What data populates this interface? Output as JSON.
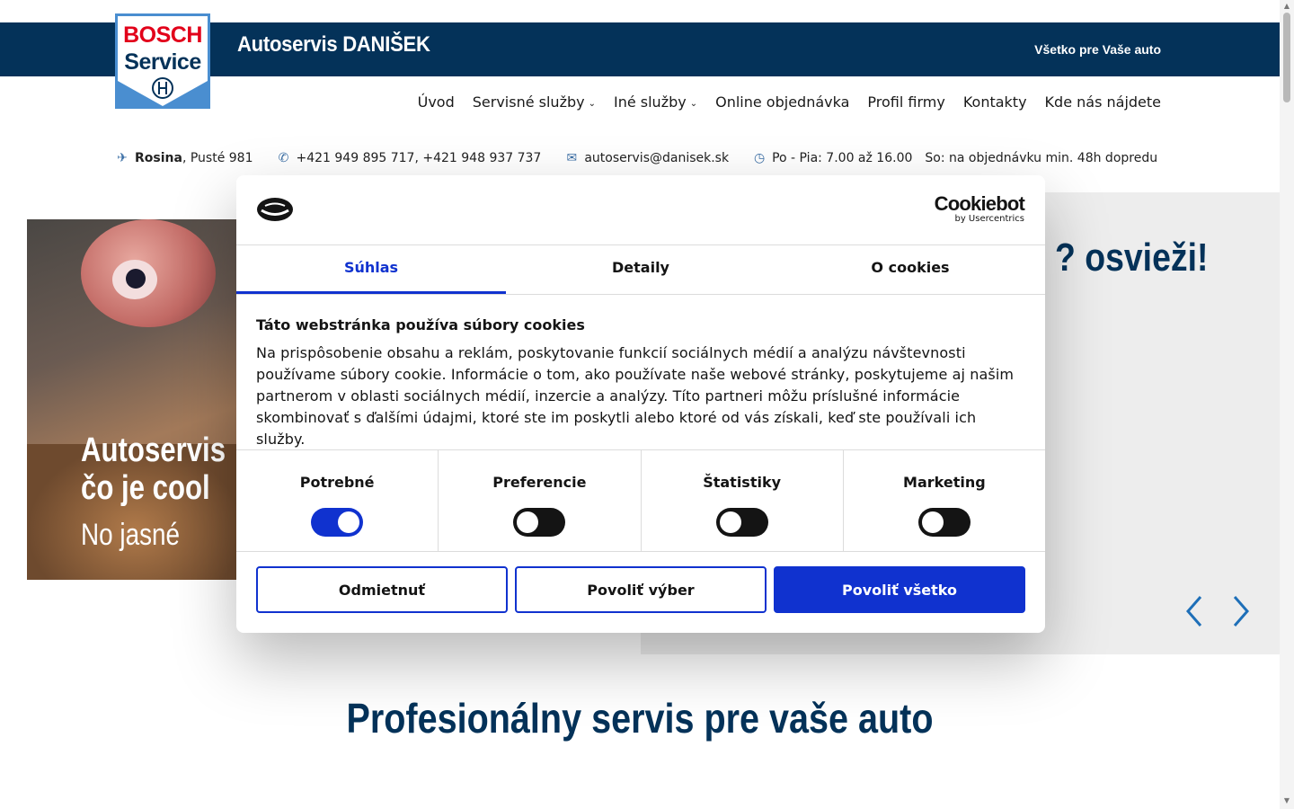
{
  "header": {
    "brand": "Autoservis DANIŠEK",
    "tagline": "Všetko pre Vaše auto",
    "logo": {
      "line1": "BOSCH",
      "line2": "Service"
    }
  },
  "nav": {
    "items": [
      {
        "label": "Úvod",
        "dropdown": false
      },
      {
        "label": "Servisné služby",
        "dropdown": true
      },
      {
        "label": "Iné služby",
        "dropdown": true
      },
      {
        "label": "Online objednávka",
        "dropdown": false
      },
      {
        "label": "Profil firmy",
        "dropdown": false
      },
      {
        "label": "Kontakty",
        "dropdown": false
      },
      {
        "label": "Kde nás nájdete",
        "dropdown": false
      }
    ]
  },
  "contact": {
    "location_bold": "Rosina",
    "location_rest": ", Pusté 981",
    "phone": "+421 949 895 717, +421 948 937 737",
    "email": "autoservis@danisek.sk",
    "hours": "Po - Pia: 7.00 až 16.00",
    "saturday": "So: na objednávku min. 48h dopredu"
  },
  "hero": {
    "headline_fragment": "? osvieži!",
    "image_line1": "Autoservis",
    "image_line2": "čo je cool",
    "image_line3": "No jasné"
  },
  "section": {
    "title": "Profesionálny servis pre vaše auto"
  },
  "cookie": {
    "brand": "Cookiebot",
    "brand_sub": "by Usercentrics",
    "tabs": [
      "Súhlas",
      "Detaily",
      "O cookies"
    ],
    "active_tab": 0,
    "title": "Táto webstránka používa súbory cookies",
    "body": "Na prispôsobenie obsahu a reklám, poskytovanie funkcií sociálnych médií a analýzu návštevnosti používame súbory cookie. Informácie o tom, ako používate naše webové stránky, poskytujeme aj našim partnerom v oblasti sociálnych médií, inzercie a analýzy. Títo partneri môžu príslušné informácie skombinovať s ďalšími údajmi, ktoré ste im poskytli alebo ktoré od vás získali, keď ste používali ich služby.",
    "categories": [
      {
        "label": "Potrebné",
        "on": true
      },
      {
        "label": "Preferencie",
        "on": false
      },
      {
        "label": "Štatistiky",
        "on": false
      },
      {
        "label": "Marketing",
        "on": false
      }
    ],
    "buttons": {
      "reject": "Odmietnuť",
      "allow_selection": "Povoliť výber",
      "allow_all": "Povoliť všetko"
    }
  },
  "colors": {
    "navy": "#043259",
    "accent": "#1032cf",
    "bosch_red": "#e2001a",
    "hero_gray": "#ededed"
  }
}
